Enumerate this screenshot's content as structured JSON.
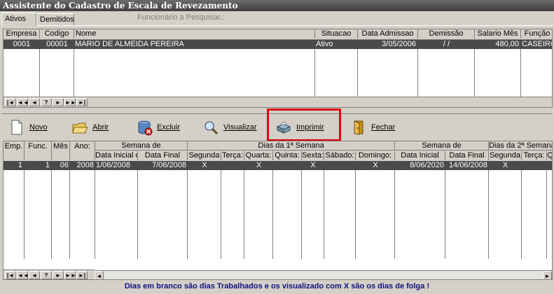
{
  "window": {
    "title": "Assistente do Cadastro de Escala de Revezamento"
  },
  "tabs": [
    {
      "label": "Ativos"
    },
    {
      "label": "Demitidos"
    }
  ],
  "search": {
    "label": "Funcionário a Pesquisar.:"
  },
  "employees": {
    "columns": [
      "Empresa",
      "Codigo",
      "Nome",
      "Situacao",
      "Data Admissao",
      "Demissão",
      "Salario Mês",
      "Função"
    ],
    "rows": [
      [
        "0001",
        "00001",
        "MARIO DE ALMEIDA PEREIRA",
        "Ativo",
        "3/05/2006",
        "/ /",
        "480,00",
        "CASEIRO"
      ]
    ]
  },
  "navigator": [
    "|◄",
    "◄◄",
    "◄",
    "?",
    "►",
    "►►",
    "►|"
  ],
  "toolbar": {
    "novo": "Novo",
    "abrir": "Abrir",
    "excluir": "Excluir",
    "visualizar": "Visualizar",
    "imprimir": "Imprimir",
    "fechar": "Fechar"
  },
  "schedule": {
    "groups": {
      "semana1": "Semana de",
      "dias1": "Dias da 1ª Semana",
      "semana2": "Semana de",
      "dias2": "Dias da 2ª Semana"
    },
    "columns": [
      "Emp.",
      "Func.",
      "Mês",
      "Ano:",
      "Data Inicial d",
      "Data Final",
      "Segunda",
      "Terça:",
      "Quarta:",
      "Quinta:",
      "Sexta:",
      "Sábado:",
      "Domingo:",
      "Data Inicial",
      "Data Final",
      "Segunda",
      "Terça:",
      "Q"
    ],
    "rows": [
      [
        "1",
        "1",
        "06",
        "2008",
        "1/06/2008",
        "7/06/2008",
        "X",
        "",
        "X",
        "",
        "X",
        "",
        "X",
        "8/06/2020",
        "14/06/2008",
        "X",
        "",
        ""
      ]
    ]
  },
  "footer": {
    "text": "Dias em branco são dias Trabalhados e os visualizado com X são os dias de folga !"
  },
  "colors": {
    "selection": "#4a4a4a",
    "highlight": "#e0000f",
    "footer_text": "#10107f"
  }
}
